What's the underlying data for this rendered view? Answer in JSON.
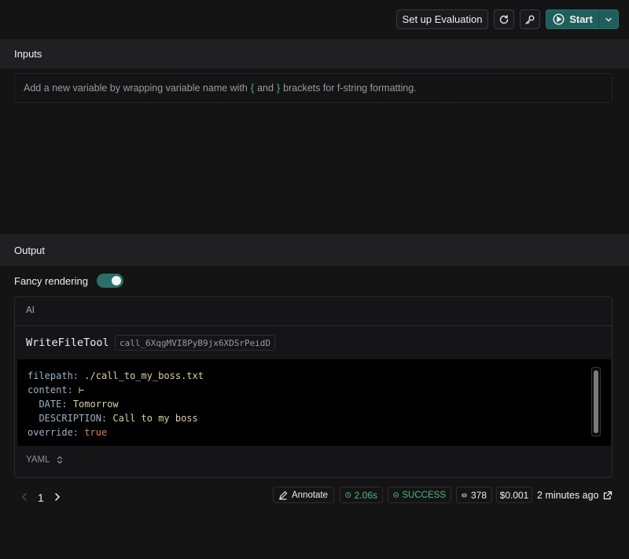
{
  "toolbar": {
    "setup_label": "Set up Evaluation",
    "start_label": "Start"
  },
  "inputs": {
    "title": "Inputs",
    "hint_before": "Add a new variable by wrapping variable name with",
    "open_brace": "{",
    "and_text": "and",
    "close_brace": "}",
    "hint_after": "brackets for f-string formatting."
  },
  "output": {
    "title": "Output",
    "fancy_label": "Fancy rendering",
    "fancy_enabled": true,
    "role": "AI",
    "tool_name": "WriteFileTool",
    "call_id": "call_6XqgMVI8PyB9jx6XDSrPeidD",
    "code": {
      "filepath_key": "filepath:",
      "filepath_val": "./call_to_my_boss.txt",
      "content_key": "content:",
      "content_val": "⊢",
      "date_key": "DATE:",
      "date_val": "Tomorrow",
      "desc_key": "DESCRIPTION:",
      "desc_val": "Call to my boss",
      "override_key": "override:",
      "override_val": "true"
    },
    "format": "YAML"
  },
  "pager": {
    "page": "1"
  },
  "run": {
    "annotate_label": "Annotate",
    "latency": "2.06s",
    "status": "SUCCESS",
    "tokens": "378",
    "cost": "$0.001",
    "time_ago": "2 minutes ago"
  },
  "colors": {
    "accent": "#1f5f5b",
    "success": "#53b77e",
    "background": "#141415"
  }
}
